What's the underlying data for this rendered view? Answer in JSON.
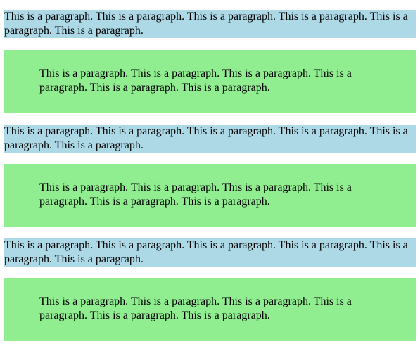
{
  "paragraphs": [
    {
      "style": "plain",
      "text": "This is a paragraph. This is a paragraph. This is a paragraph. This is a paragraph. This is a paragraph. This is a paragraph."
    },
    {
      "style": "padded",
      "text": "This is a paragraph. This is a paragraph. This is a paragraph. This is a paragraph. This is a paragraph. This is a paragraph."
    },
    {
      "style": "plain",
      "text": "This is a paragraph. This is a paragraph. This is a paragraph. This is a paragraph. This is a paragraph. This is a paragraph."
    },
    {
      "style": "padded",
      "text": "This is a paragraph. This is a paragraph. This is a paragraph. This is a paragraph. This is a paragraph. This is a paragraph."
    },
    {
      "style": "plain",
      "text": "This is a paragraph. This is a paragraph. This is a paragraph. This is a paragraph. This is a paragraph. This is a paragraph."
    },
    {
      "style": "padded",
      "text": "This is a paragraph. This is a paragraph. This is a paragraph. This is a paragraph. This is a paragraph. This is a paragraph."
    }
  ],
  "colors": {
    "plain_background": "#add8e6",
    "padded_background": "#90ee90",
    "text": "#000000"
  }
}
